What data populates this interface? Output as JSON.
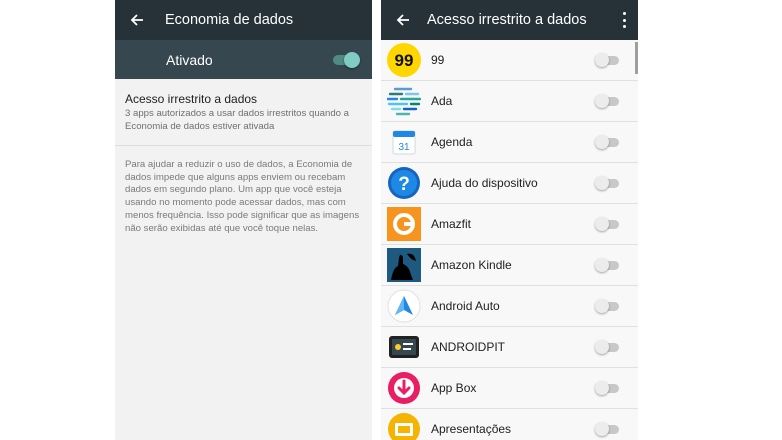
{
  "left": {
    "title": "Economia de dados",
    "master_label": "Ativado",
    "master_on": true,
    "setting_title": "Acesso irrestrito a dados",
    "setting_summary": "3 apps autorizados a usar dados irrestritos quando a Economia de dados estiver ativada",
    "info_text": "Para ajudar a reduzir o uso de dados, a Economia de dados impede que alguns apps enviem ou recebam dados em segundo plano. Um app que você esteja usando no momento pode acessar dados, mas com menos frequência. Isso pode significar que as imagens não serão exibidas até que você toque nelas."
  },
  "right": {
    "title": "Acesso irrestrito a dados",
    "apps": [
      {
        "name": "99",
        "icon": "99-icon",
        "enabled": false
      },
      {
        "name": "Ada",
        "icon": "ada-icon",
        "enabled": false
      },
      {
        "name": "Agenda",
        "icon": "calendar-icon",
        "icon_text": "31",
        "enabled": false
      },
      {
        "name": "Ajuda do dispositivo",
        "icon": "help-icon",
        "icon_text": "?",
        "enabled": false
      },
      {
        "name": "Amazfit",
        "icon": "amazfit-icon",
        "enabled": false
      },
      {
        "name": "Amazon Kindle",
        "icon": "kindle-icon",
        "enabled": false
      },
      {
        "name": "Android Auto",
        "icon": "android-auto-icon",
        "enabled": false
      },
      {
        "name": "ANDROIDPIT",
        "icon": "androidpit-icon",
        "enabled": false
      },
      {
        "name": "App Box",
        "icon": "app-box-icon",
        "enabled": false
      },
      {
        "name": "Apresentações",
        "icon": "slides-icon",
        "enabled": false
      }
    ]
  },
  "colors": {
    "toolbar": "#263238",
    "master_bar": "#37474f",
    "accent": "#80cbc4"
  }
}
